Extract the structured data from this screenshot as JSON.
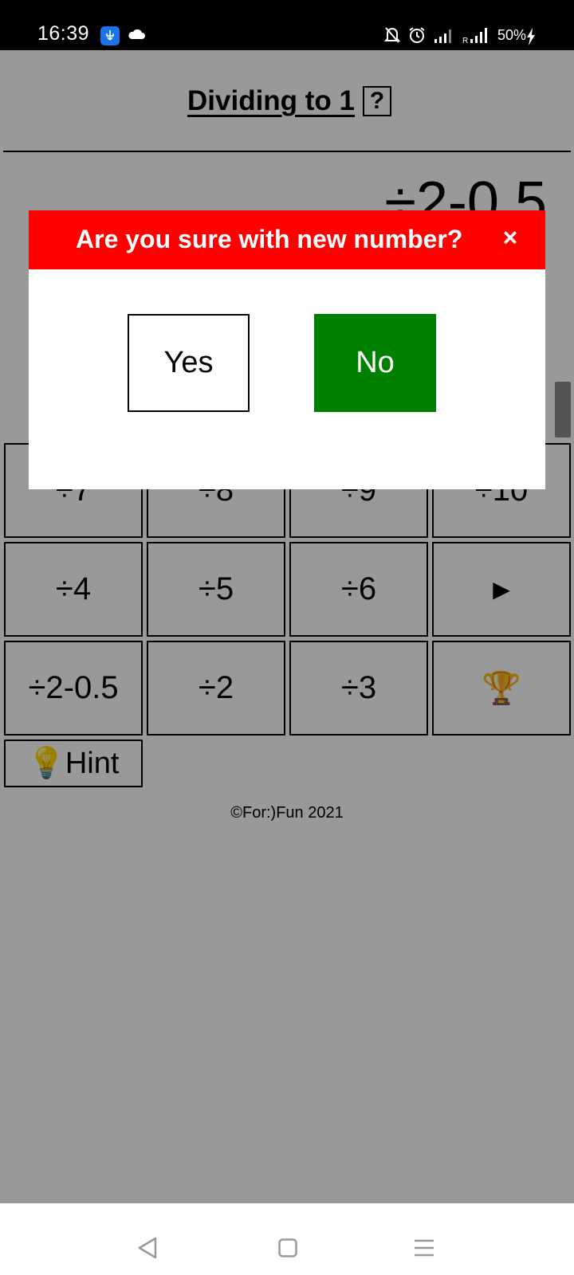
{
  "status_bar": {
    "time": "16:39",
    "battery": "50%",
    "icons": [
      "usb-debug-icon",
      "cloud-icon",
      "mute-icon",
      "alarm-icon",
      "signal-icon",
      "roaming-signal-icon",
      "charging-bolt-icon"
    ]
  },
  "app": {
    "title": "Dividing to 1",
    "help_label": "?",
    "current_number": "÷2-0.5",
    "grid": [
      [
        "÷7",
        "÷8",
        "÷9",
        "÷10"
      ],
      [
        "÷4",
        "÷5",
        "÷6",
        "▶"
      ],
      [
        "÷2-0.5",
        "÷2",
        "÷3",
        "🏆"
      ]
    ],
    "hint_label": "💡Hint",
    "copyright": "©For:)Fun 2021"
  },
  "dialog": {
    "title": "Are you sure with new number?",
    "close_label": "×",
    "yes_label": "Yes",
    "no_label": "No",
    "header_color": "#ff0000",
    "no_color": "#008000"
  },
  "nav_bar": {
    "icons": [
      "back-icon",
      "home-icon",
      "recents-menu-icon"
    ]
  }
}
